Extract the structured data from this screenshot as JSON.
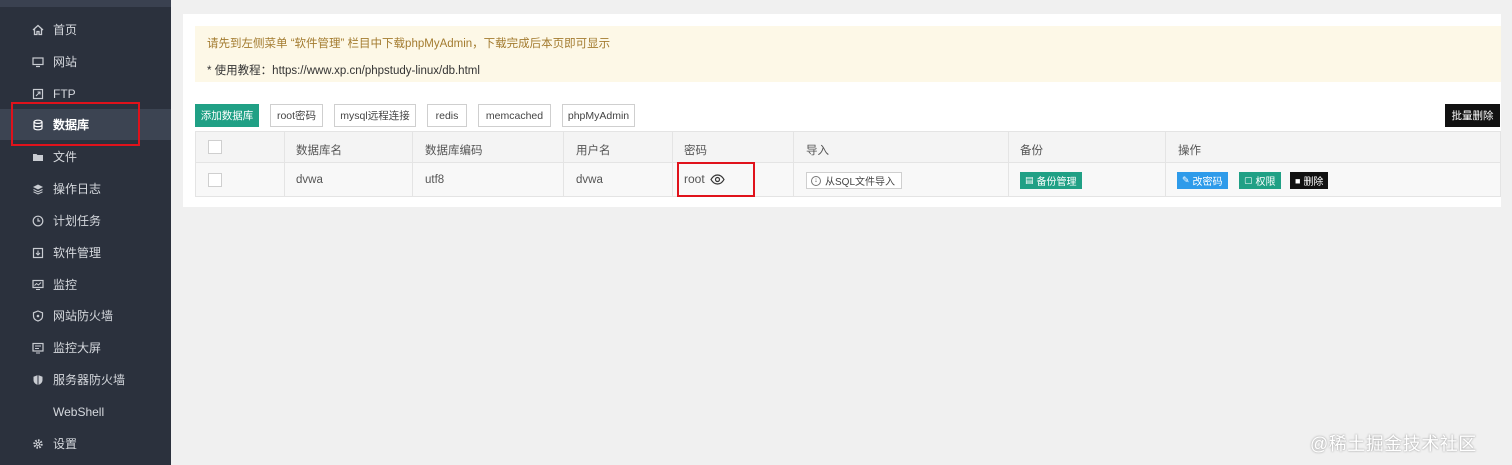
{
  "sidebar": {
    "items": [
      {
        "label": "首页",
        "icon": "home-icon"
      },
      {
        "label": "网站",
        "icon": "monitor-icon"
      },
      {
        "label": "FTP",
        "icon": "ftp-icon"
      },
      {
        "label": "数据库",
        "icon": "database-icon",
        "active": true
      },
      {
        "label": "文件",
        "icon": "folder-icon"
      },
      {
        "label": "操作日志",
        "icon": "layers-icon"
      },
      {
        "label": "计划任务",
        "icon": "clock-icon"
      },
      {
        "label": "软件管理",
        "icon": "download-box-icon"
      },
      {
        "label": "监控",
        "icon": "monitor-chart-icon"
      },
      {
        "label": "网站防火墙",
        "icon": "shield-outline-icon"
      },
      {
        "label": "监控大屏",
        "icon": "screen-icon"
      },
      {
        "label": "服务器防火墙",
        "icon": "shield-half-icon"
      },
      {
        "label": "WebShell",
        "icon": "terminal-icon"
      },
      {
        "label": "设置",
        "icon": "gear-icon"
      }
    ]
  },
  "notice": {
    "line1": "请先到左侧菜单 “软件管理” 栏目中下载phpMyAdmin，下载完成后本页即可显示",
    "line2_prefix": "* 使用教程：",
    "line2_url": "https://www.xp.cn/phpstudy-linux/db.html"
  },
  "toolbar": {
    "add_db": "添加数据库",
    "root_pw": "root密码",
    "mysql_remote": "mysql远程连接",
    "redis": "redis",
    "memcached": "memcached",
    "phpmyadmin": "phpMyAdmin",
    "batch_delete": "批量删除"
  },
  "table": {
    "headers": [
      "数据库名",
      "数据库编码",
      "用户名",
      "密码",
      "导入",
      "备份",
      "操作"
    ],
    "rows": [
      {
        "db_name": "dvwa",
        "encoding": "utf8",
        "username": "dvwa",
        "password": "root",
        "import_label": "从SQL文件导入",
        "backup_label": "备份管理",
        "change_pw_label": "改密码",
        "perm_label": "权限",
        "delete_label": "删除"
      }
    ]
  },
  "colors": {
    "sidebar_bg": "#2b313d",
    "accent_teal": "#20a085",
    "accent_blue": "#2e9bea",
    "highlight_red": "#e0121b"
  },
  "watermark": "@稀土掘金技术社区"
}
